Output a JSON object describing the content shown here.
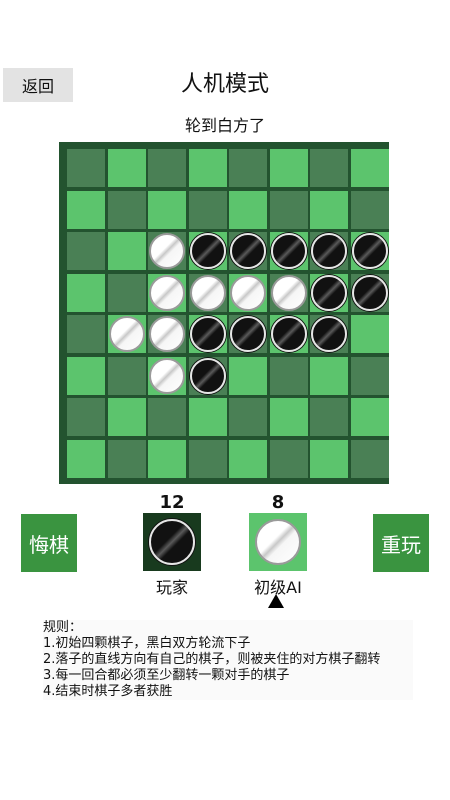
{
  "header": {
    "back_label": "返回",
    "title": "人机模式",
    "turn_text": "轮到白方了"
  },
  "colors": {
    "light_square": "#5cc46d",
    "dark_square": "#4a8055",
    "board_border": "#23532f",
    "button_green": "#3a9440"
  },
  "board": {
    "size": 8,
    "rows": [
      "........",
      "........",
      "..WBBBBB",
      "..WWWWBB",
      ".WWBBBB.",
      "..WB....",
      "........",
      "........"
    ]
  },
  "controls": {
    "undo_label": "悔棋",
    "restart_label": "重玩"
  },
  "players": {
    "black": {
      "name": "玩家",
      "score": "12",
      "piece": "black"
    },
    "white": {
      "name": "初级AI",
      "score": "8",
      "piece": "white",
      "current_turn": true
    }
  },
  "rules": {
    "heading": "规则：",
    "items": [
      "1.初始四颗棋子，黑白双方轮流下子",
      "2.落子的直线方向有自己的棋子，则被夹住的对方棋子翻转",
      "3.每一回合都必须至少翻转一颗对手的棋子",
      "4.结束时棋子多者获胜"
    ]
  }
}
